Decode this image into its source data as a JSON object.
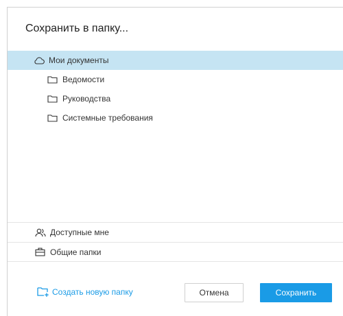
{
  "dialog": {
    "title": "Сохранить в папку..."
  },
  "tree": {
    "root": {
      "label": "Мои документы",
      "icon": "cloud-icon",
      "selected": true
    },
    "children": [
      {
        "label": "Ведомости",
        "icon": "folder-icon"
      },
      {
        "label": "Руководства",
        "icon": "folder-icon"
      },
      {
        "label": "Системные требования",
        "icon": "folder-icon"
      }
    ]
  },
  "sections": {
    "shared": {
      "label": "Доступные мне",
      "icon": "users-icon"
    },
    "common": {
      "label": "Общие папки",
      "icon": "briefcase-icon"
    }
  },
  "footer": {
    "create_folder_label": "Создать новую папку",
    "create_folder_icon": "folder-plus-icon",
    "cancel_label": "Отмена",
    "save_label": "Сохранить"
  },
  "colors": {
    "accent": "#1a9be6",
    "selected_row": "#c5e4f3"
  }
}
